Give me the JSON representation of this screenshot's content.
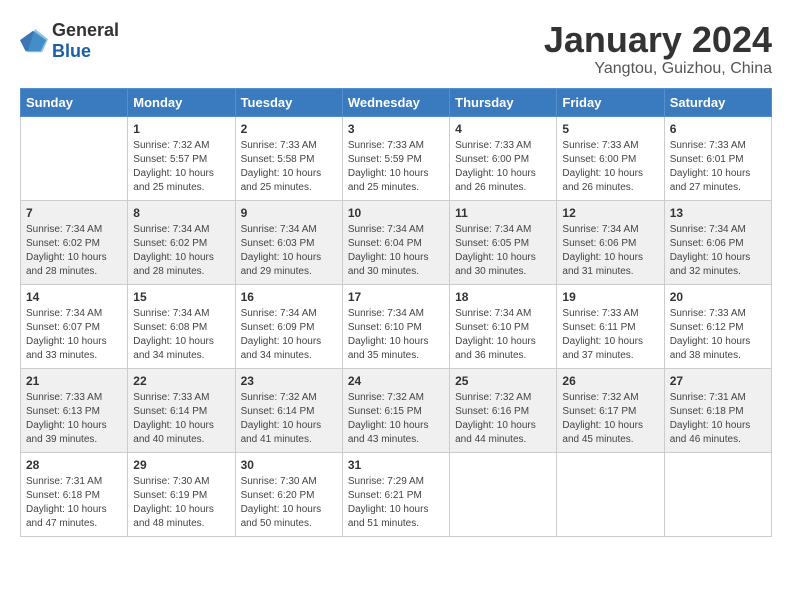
{
  "logo": {
    "general": "General",
    "blue": "Blue"
  },
  "title": "January 2024",
  "location": "Yangtou, Guizhou, China",
  "weekdays": [
    "Sunday",
    "Monday",
    "Tuesday",
    "Wednesday",
    "Thursday",
    "Friday",
    "Saturday"
  ],
  "weeks": [
    [
      {
        "day": "",
        "sunrise": "",
        "sunset": "",
        "daylight": ""
      },
      {
        "day": "1",
        "sunrise": "Sunrise: 7:32 AM",
        "sunset": "Sunset: 5:57 PM",
        "daylight": "Daylight: 10 hours and 25 minutes."
      },
      {
        "day": "2",
        "sunrise": "Sunrise: 7:33 AM",
        "sunset": "Sunset: 5:58 PM",
        "daylight": "Daylight: 10 hours and 25 minutes."
      },
      {
        "day": "3",
        "sunrise": "Sunrise: 7:33 AM",
        "sunset": "Sunset: 5:59 PM",
        "daylight": "Daylight: 10 hours and 25 minutes."
      },
      {
        "day": "4",
        "sunrise": "Sunrise: 7:33 AM",
        "sunset": "Sunset: 6:00 PM",
        "daylight": "Daylight: 10 hours and 26 minutes."
      },
      {
        "day": "5",
        "sunrise": "Sunrise: 7:33 AM",
        "sunset": "Sunset: 6:00 PM",
        "daylight": "Daylight: 10 hours and 26 minutes."
      },
      {
        "day": "6",
        "sunrise": "Sunrise: 7:33 AM",
        "sunset": "Sunset: 6:01 PM",
        "daylight": "Daylight: 10 hours and 27 minutes."
      }
    ],
    [
      {
        "day": "7",
        "sunrise": "Sunrise: 7:34 AM",
        "sunset": "Sunset: 6:02 PM",
        "daylight": "Daylight: 10 hours and 28 minutes."
      },
      {
        "day": "8",
        "sunrise": "Sunrise: 7:34 AM",
        "sunset": "Sunset: 6:02 PM",
        "daylight": "Daylight: 10 hours and 28 minutes."
      },
      {
        "day": "9",
        "sunrise": "Sunrise: 7:34 AM",
        "sunset": "Sunset: 6:03 PM",
        "daylight": "Daylight: 10 hours and 29 minutes."
      },
      {
        "day": "10",
        "sunrise": "Sunrise: 7:34 AM",
        "sunset": "Sunset: 6:04 PM",
        "daylight": "Daylight: 10 hours and 30 minutes."
      },
      {
        "day": "11",
        "sunrise": "Sunrise: 7:34 AM",
        "sunset": "Sunset: 6:05 PM",
        "daylight": "Daylight: 10 hours and 30 minutes."
      },
      {
        "day": "12",
        "sunrise": "Sunrise: 7:34 AM",
        "sunset": "Sunset: 6:06 PM",
        "daylight": "Daylight: 10 hours and 31 minutes."
      },
      {
        "day": "13",
        "sunrise": "Sunrise: 7:34 AM",
        "sunset": "Sunset: 6:06 PM",
        "daylight": "Daylight: 10 hours and 32 minutes."
      }
    ],
    [
      {
        "day": "14",
        "sunrise": "Sunrise: 7:34 AM",
        "sunset": "Sunset: 6:07 PM",
        "daylight": "Daylight: 10 hours and 33 minutes."
      },
      {
        "day": "15",
        "sunrise": "Sunrise: 7:34 AM",
        "sunset": "Sunset: 6:08 PM",
        "daylight": "Daylight: 10 hours and 34 minutes."
      },
      {
        "day": "16",
        "sunrise": "Sunrise: 7:34 AM",
        "sunset": "Sunset: 6:09 PM",
        "daylight": "Daylight: 10 hours and 34 minutes."
      },
      {
        "day": "17",
        "sunrise": "Sunrise: 7:34 AM",
        "sunset": "Sunset: 6:10 PM",
        "daylight": "Daylight: 10 hours and 35 minutes."
      },
      {
        "day": "18",
        "sunrise": "Sunrise: 7:34 AM",
        "sunset": "Sunset: 6:10 PM",
        "daylight": "Daylight: 10 hours and 36 minutes."
      },
      {
        "day": "19",
        "sunrise": "Sunrise: 7:33 AM",
        "sunset": "Sunset: 6:11 PM",
        "daylight": "Daylight: 10 hours and 37 minutes."
      },
      {
        "day": "20",
        "sunrise": "Sunrise: 7:33 AM",
        "sunset": "Sunset: 6:12 PM",
        "daylight": "Daylight: 10 hours and 38 minutes."
      }
    ],
    [
      {
        "day": "21",
        "sunrise": "Sunrise: 7:33 AM",
        "sunset": "Sunset: 6:13 PM",
        "daylight": "Daylight: 10 hours and 39 minutes."
      },
      {
        "day": "22",
        "sunrise": "Sunrise: 7:33 AM",
        "sunset": "Sunset: 6:14 PM",
        "daylight": "Daylight: 10 hours and 40 minutes."
      },
      {
        "day": "23",
        "sunrise": "Sunrise: 7:32 AM",
        "sunset": "Sunset: 6:14 PM",
        "daylight": "Daylight: 10 hours and 41 minutes."
      },
      {
        "day": "24",
        "sunrise": "Sunrise: 7:32 AM",
        "sunset": "Sunset: 6:15 PM",
        "daylight": "Daylight: 10 hours and 43 minutes."
      },
      {
        "day": "25",
        "sunrise": "Sunrise: 7:32 AM",
        "sunset": "Sunset: 6:16 PM",
        "daylight": "Daylight: 10 hours and 44 minutes."
      },
      {
        "day": "26",
        "sunrise": "Sunrise: 7:32 AM",
        "sunset": "Sunset: 6:17 PM",
        "daylight": "Daylight: 10 hours and 45 minutes."
      },
      {
        "day": "27",
        "sunrise": "Sunrise: 7:31 AM",
        "sunset": "Sunset: 6:18 PM",
        "daylight": "Daylight: 10 hours and 46 minutes."
      }
    ],
    [
      {
        "day": "28",
        "sunrise": "Sunrise: 7:31 AM",
        "sunset": "Sunset: 6:18 PM",
        "daylight": "Daylight: 10 hours and 47 minutes."
      },
      {
        "day": "29",
        "sunrise": "Sunrise: 7:30 AM",
        "sunset": "Sunset: 6:19 PM",
        "daylight": "Daylight: 10 hours and 48 minutes."
      },
      {
        "day": "30",
        "sunrise": "Sunrise: 7:30 AM",
        "sunset": "Sunset: 6:20 PM",
        "daylight": "Daylight: 10 hours and 50 minutes."
      },
      {
        "day": "31",
        "sunrise": "Sunrise: 7:29 AM",
        "sunset": "Sunset: 6:21 PM",
        "daylight": "Daylight: 10 hours and 51 minutes."
      },
      {
        "day": "",
        "sunrise": "",
        "sunset": "",
        "daylight": ""
      },
      {
        "day": "",
        "sunrise": "",
        "sunset": "",
        "daylight": ""
      },
      {
        "day": "",
        "sunrise": "",
        "sunset": "",
        "daylight": ""
      }
    ]
  ]
}
